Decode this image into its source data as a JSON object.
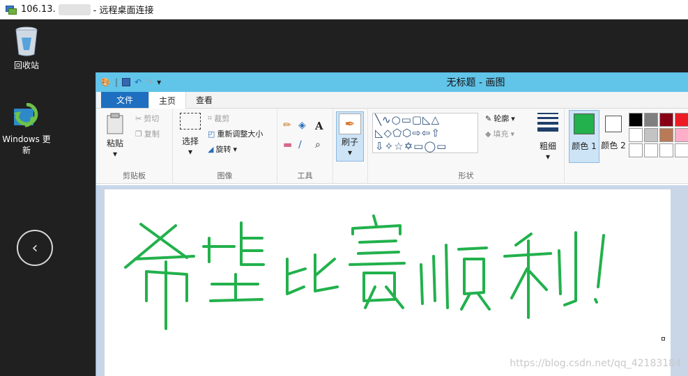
{
  "rdp": {
    "title_prefix": "106.13.",
    "title_suffix": "- 远程桌面连接"
  },
  "desktop": {
    "icons": [
      {
        "label": "回收站"
      },
      {
        "label": "Windows 更\n新"
      }
    ]
  },
  "paint": {
    "title": "无标题 - 画图",
    "tabs": {
      "file": "文件",
      "home": "主页",
      "view": "查看"
    },
    "clipboard": {
      "paste": "粘贴",
      "cut": "剪切",
      "copy": "复制",
      "label": "剪贴板"
    },
    "image": {
      "select": "选择",
      "crop": "裁剪",
      "resize": "重新调整大小",
      "rotate": "旋转",
      "label": "图像"
    },
    "tools": {
      "label": "工具"
    },
    "brush": {
      "label": "刷子"
    },
    "shapes": {
      "outline": "轮廓",
      "fill": "填充",
      "label": "形状"
    },
    "size": {
      "label": "粗细"
    },
    "colors": {
      "color1": "颜色 1",
      "color2": "颜色 2",
      "color1_value": "#22b14c",
      "color2_value": "#ffffff",
      "palette": [
        "#000000",
        "#7f7f7f",
        "#880015",
        "#ed1c24",
        "#ffffff",
        "#c3c3c3",
        "#b97a57",
        "#ffaec9",
        "#ffffff",
        "#ffffff",
        "#ffffff",
        "#ffffff"
      ]
    },
    "canvas": {
      "handwriting": "希望比赛顺利!",
      "ink_color": "#22b14c"
    }
  },
  "watermark": "https://blog.csdn.net/qq_42183184"
}
